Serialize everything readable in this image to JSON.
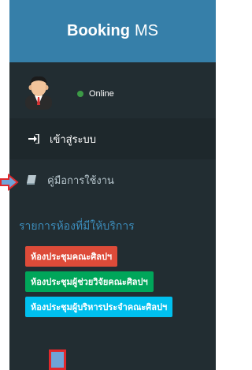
{
  "header": {
    "title_bold": "Booking",
    "title_light": "MS"
  },
  "user": {
    "status": "Online",
    "status_color": "#3c9a46"
  },
  "menu": [
    {
      "label": "เข้าสู่ระบบ",
      "icon": "sign-in-icon",
      "active": true
    },
    {
      "label": "คู่มือการใช้งาน",
      "icon": "book-icon",
      "active": false
    }
  ],
  "rooms": {
    "heading": "รายการห้องที่มีให้บริการ",
    "items": [
      {
        "label": "ห้องประชุมคณะศิลปฯ",
        "color": "#dd4b39"
      },
      {
        "label": "ห้องประชุมผู้ช่วยวิจัยคณะศิลปฯ",
        "color": "#00a65a"
      },
      {
        "label": "ห้องประชุมผู้บริหารประจำคณะศิลปฯ",
        "color": "#00c0ef"
      }
    ]
  },
  "colors": {
    "sidebar": "#222d32",
    "header": "#367fa9",
    "accent": "#3c8dbc"
  }
}
